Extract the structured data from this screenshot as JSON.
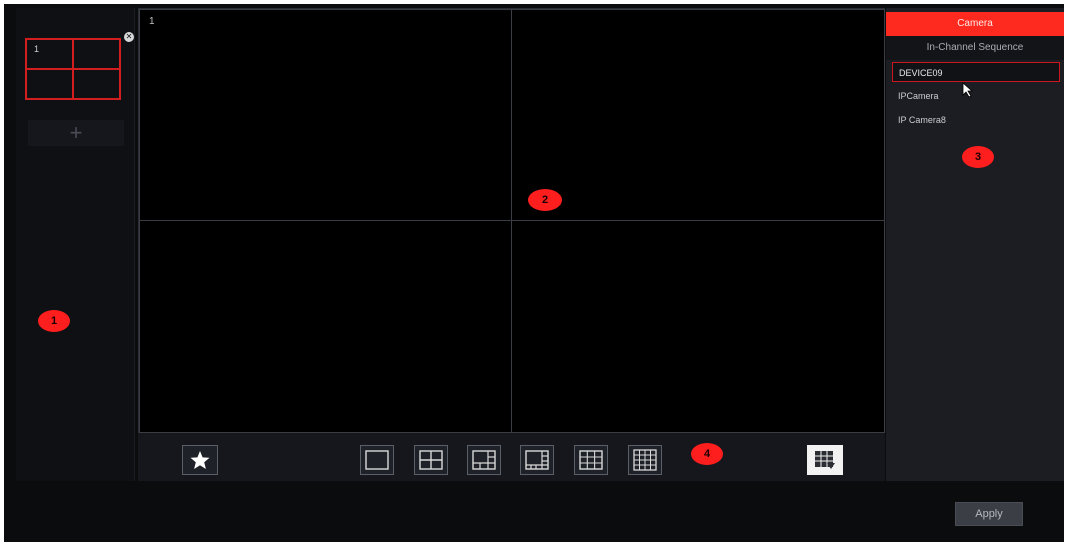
{
  "left_panel": {
    "layout_thumb_number": "1",
    "close_glyph": "✕",
    "add_glyph": "+",
    "marker_label": "1"
  },
  "grid": {
    "cell_number": "1",
    "marker_label": "2"
  },
  "toolbar": {
    "marker_label": "4",
    "buttons": [
      {
        "icon": "favorite-star-icon"
      },
      {
        "icon": "layout-1-icon"
      },
      {
        "icon": "layout-4-icon"
      },
      {
        "icon": "layout-6-icon"
      },
      {
        "icon": "layout-8-icon"
      },
      {
        "icon": "layout-9-icon"
      },
      {
        "icon": "layout-16-icon"
      },
      {
        "icon": "more-layouts-icon"
      }
    ]
  },
  "right_panel": {
    "tabs": {
      "camera": "Camera",
      "sequence": "In-Channel Sequence"
    },
    "cameras": [
      "DEVICE09",
      "IPCamera",
      "IP Camera8"
    ],
    "marker_label": "3"
  },
  "footer": {
    "apply_label": "Apply"
  },
  "colors": {
    "accent": "#ff2a1f",
    "panel_bg": "#1b1d22",
    "grid_bg": "#000000"
  }
}
